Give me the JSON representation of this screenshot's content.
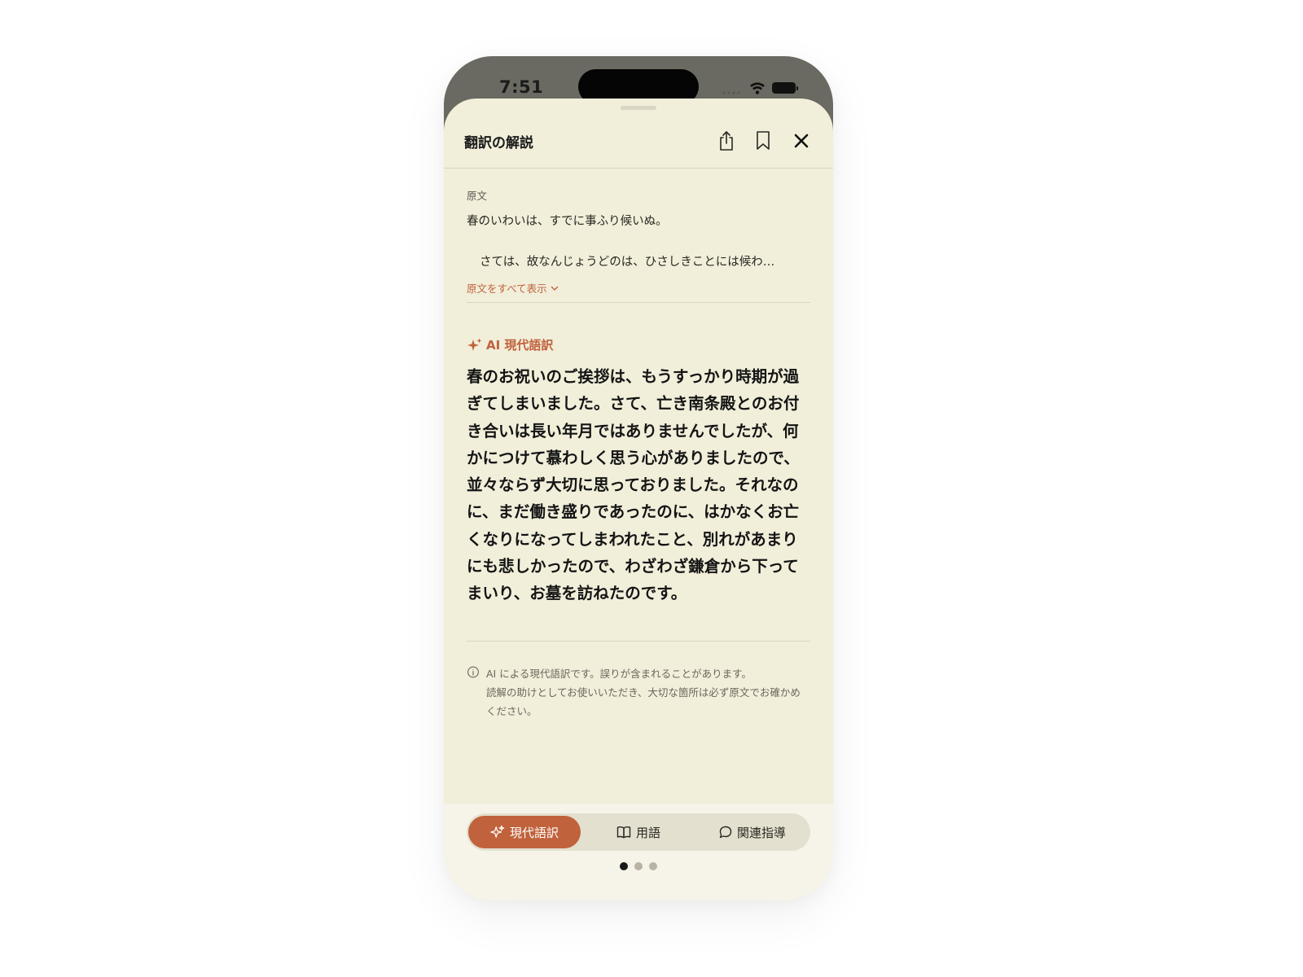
{
  "status_bar": {
    "time": "7:51"
  },
  "header": {
    "title": "翻訳の解説",
    "icons": [
      "share-icon",
      "bookmark-icon",
      "close-icon"
    ]
  },
  "original": {
    "label": "原文",
    "line1": "春のいわいは、すでに事ふり候いぬ。",
    "line2": "さては、故なんじょうどのは、ひさしきことには候わ…",
    "show_all": "原文をすべて表示"
  },
  "translation": {
    "label": "AI 現代語訳",
    "text": "春のお祝いのご挨拶は、もうすっかり時期が過ぎてしまいました。さて、亡き南条殿とのお付き合いは長い年月ではありませんでしたが、何かにつけて慕わしく思う心がありましたので、並々ならず大切に思っておりました。それなのに、まだ働き盛りであったのに、はかなくお亡くなりになってしまわれたこと、別れがあまりにも悲しかったので、わざわざ鎌倉から下ってまいり、お墓を訪ねたのです。"
  },
  "note": {
    "line1": "AI による現代語訳です。誤りが含まれることがあります。",
    "line2": "読解の助けとしてお使いいただき、大切な箇所は必ず原文でお確かめください。"
  },
  "tabs": [
    {
      "label": "現代語訳",
      "icon": "sparkle-icon",
      "active": true
    },
    {
      "label": "用語",
      "icon": "book-icon",
      "active": false
    },
    {
      "label": "関連指導",
      "icon": "chat-bubble-icon",
      "active": false
    }
  ],
  "page_indicator": {
    "count": 3,
    "current": 1
  },
  "colors": {
    "accent": "#c0623c",
    "sheet_background": "#f1eeda",
    "status_bar_background": "#6a6a62"
  }
}
